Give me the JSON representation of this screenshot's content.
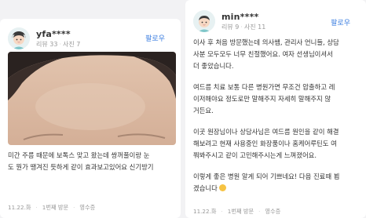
{
  "reviews": [
    {
      "username": "yfa****",
      "stats_reviews": "리뷰 33",
      "stats_photos": "사진 7",
      "follow_label": "팔로우",
      "lines": [
        "미간 주름 때문에 보톡스 맞고 왔는데 쌍꺼풀이랑 눈",
        "도 뭔가 땡겨진 듯하게 같이 효과보고있어요 신기방기"
      ],
      "date": "11.22.화",
      "visit": "1번째 방문",
      "receipt": "영수증"
    },
    {
      "username": "min****",
      "stats_reviews": "리뷰 9",
      "stats_photos": "사진 11",
      "follow_label": "팔로우",
      "paragraphs": [
        [
          "이사 후 처음 방문했는데 의사쌤, 관리사 언니들, 상담",
          "사분 모두모두 너무 친절했어요. 여자 선생님이셔서",
          "더 좋았습니다."
        ],
        [
          "여드름 치료 보통 다른 병원가면 무조건 압출하고 레",
          "이저해야요 정도로만 말해주지 자세히 말해주지 않",
          "거든요."
        ],
        [
          "이곳 원장님이나 상담사님은 여드름 원인을 같이 해결",
          "해보려고 현재 사용중인 화장품이나 홈케어루틴도 여",
          "쭤봐주시고 같이 고민해주시는게 느껴졌어요."
        ],
        [
          "이렇게 좋은 병원 알게 되어 기쁘네요! 다음 진료때 뵙",
          "겠습니다"
        ]
      ],
      "date": "11.22.화",
      "visit": "1번째 방문",
      "receipt": "영수증"
    }
  ],
  "icons": {
    "avatar": "avatar-icon",
    "emoji": "smile-emoji-icon"
  },
  "colors": {
    "follow": "#3f80e0",
    "card_bg": "#ffffff",
    "page_bg": "#f2f2f4"
  }
}
